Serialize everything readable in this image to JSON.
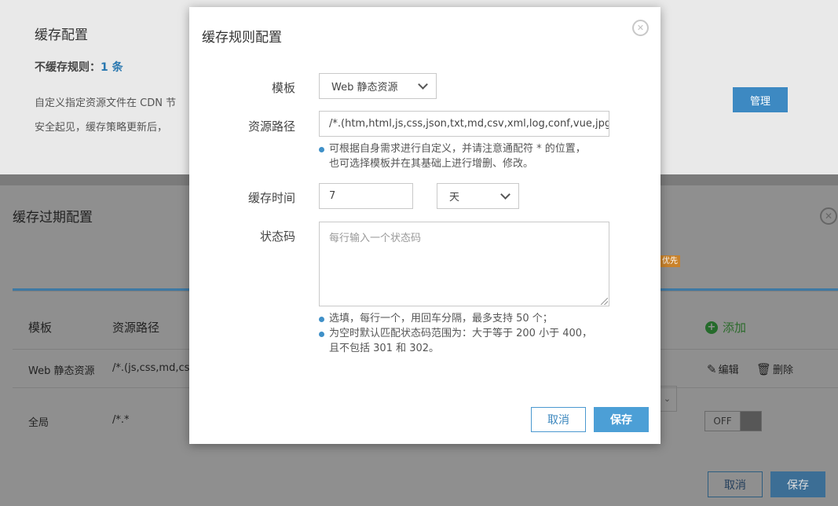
{
  "background": {
    "cache_config": {
      "title": "缓存配置",
      "no_cache_rule_label": "不缓存规则：",
      "no_cache_rule_count": "1 条",
      "desc_line1": "自定义指定资源文件在 CDN 节",
      "desc_line2": "安全起见，缓存策略更新后，",
      "manage_label": "管理"
    },
    "expire_config": {
      "title": "缓存过期配置",
      "priority_badge": "优先",
      "table": {
        "headers": [
          "模板",
          "资源路径"
        ],
        "add_label": "添加",
        "rows": [
          {
            "template": "Web 静态资源",
            "path": "/*.(js,css,md,cs",
            "edit_label": "编辑",
            "delete_label": "删除"
          },
          {
            "template": "全局",
            "path": "/*.*",
            "toggle_label": "OFF"
          }
        ]
      },
      "cancel_label": "取消",
      "save_label": "保存"
    }
  },
  "modal": {
    "title": "缓存规则配置",
    "fields": {
      "template_label": "模板",
      "template_value": "Web 静态资源",
      "path_label": "资源路径",
      "path_value": "/*.(htm,html,js,css,json,txt,md,csv,xml,log,conf,vue,jpg",
      "path_hint_1": "可根据自身需求进行自定义，并请注意通配符 * 的位置，",
      "path_hint_2": "也可选择模板并在其基础上进行增删、修改。",
      "cache_time_label": "缓存时间",
      "cache_time_value": "7",
      "cache_unit_value": "天",
      "status_code_label": "状态码",
      "status_code_placeholder": "每行输入一个状态码",
      "status_hint_1": "选填，每行一个，用回车分隔，最多支持 50 个；",
      "status_hint_2": "为空时默认匹配状态码范围为：大于等于 200 小于 400，",
      "status_hint_3": "且不包括 301 和 302。"
    },
    "cancel_label": "取消",
    "save_label": "保存"
  },
  "colors": {
    "primary": "#4c9fd6",
    "overlay_bg": "#8f8f8f",
    "hint_dot": "#3f90c8"
  }
}
